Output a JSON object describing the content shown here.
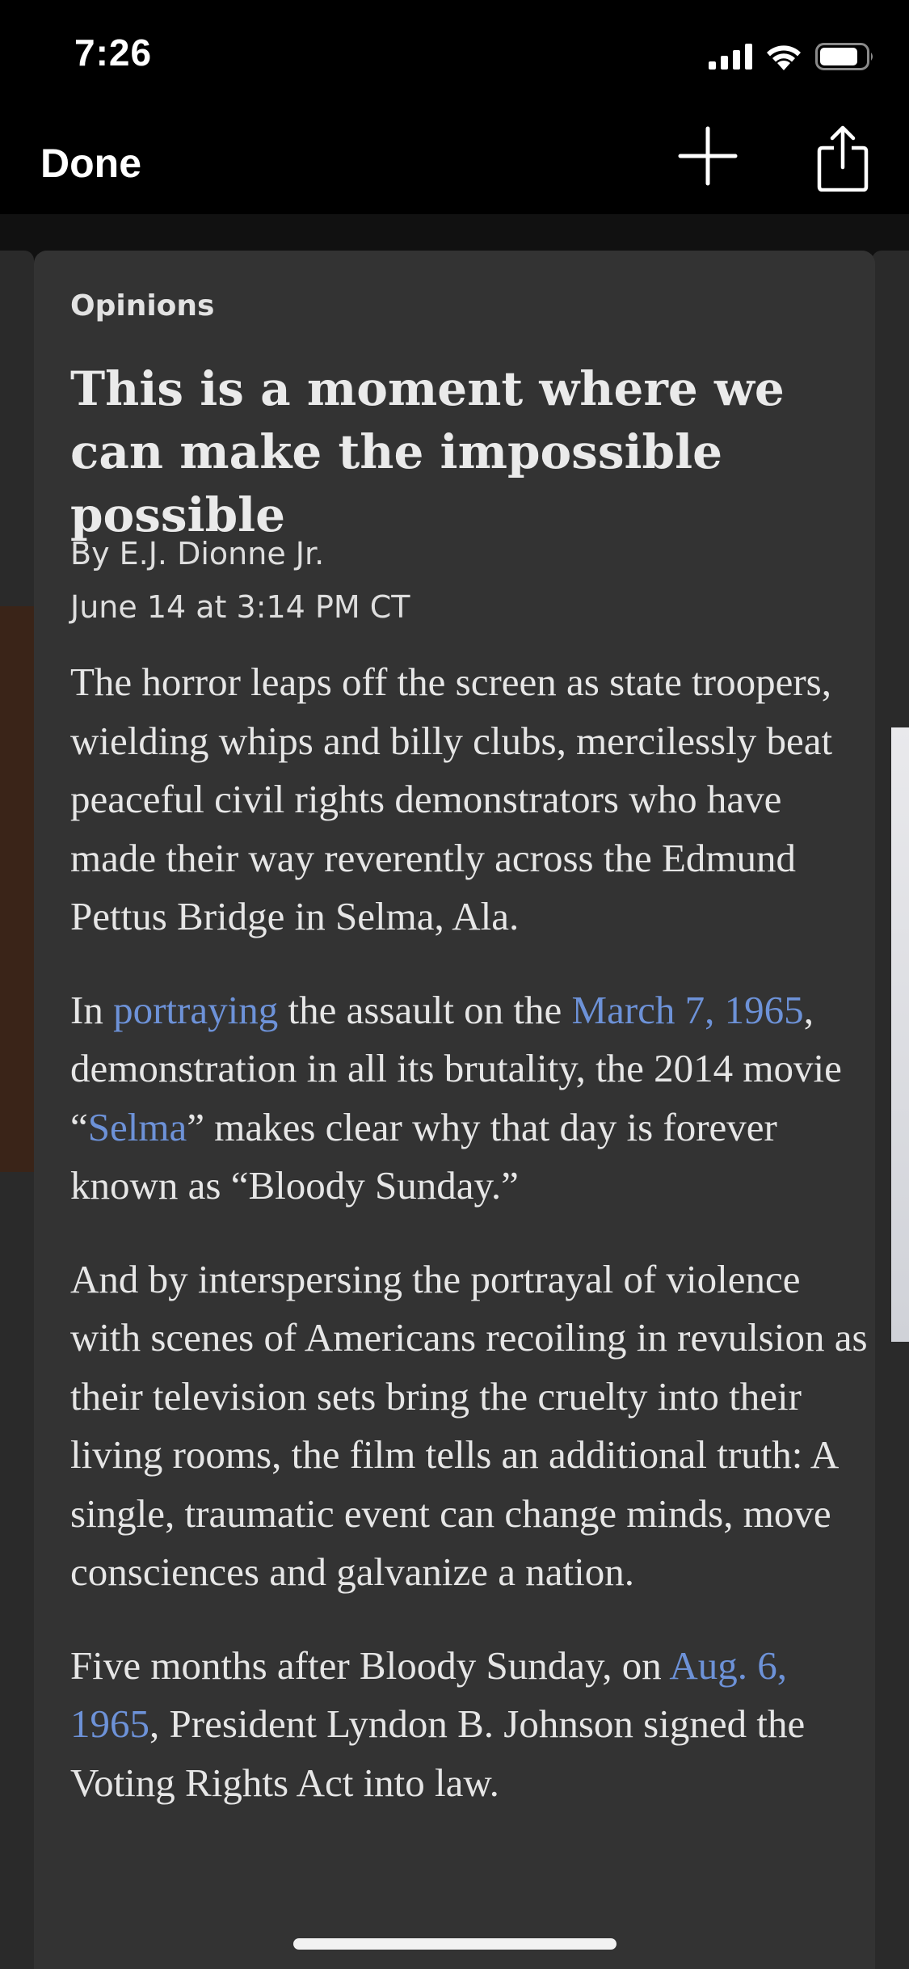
{
  "status_bar": {
    "time": "7:26"
  },
  "nav": {
    "done_label": "Done",
    "add_icon": "plus-icon",
    "share_icon": "share-icon"
  },
  "article": {
    "section": "Opinions",
    "headline": "This is a moment where we can make the impossible possible",
    "author": "By E.J. Dionne Jr.",
    "date": "June 14 at 3:14 PM CT",
    "paragraphs": [
      [
        {
          "text": "The horror leaps off the screen as state troopers, wielding whips and billy clubs, mercilessly beat peaceful civil rights demonstrators who have made their way reverently across the Edmund Pettus Bridge in Selma, Ala."
        }
      ],
      [
        {
          "text": "In "
        },
        {
          "text": "portraying",
          "link": true
        },
        {
          "text": " the assault on the "
        },
        {
          "text": "March 7, 1965",
          "link": true
        },
        {
          "text": ", demonstration in all its brutality, the 2014 movie “"
        },
        {
          "text": "Selma",
          "link": true
        },
        {
          "text": "” makes clear why that day is forever known as “Bloody Sunday.”"
        }
      ],
      [
        {
          "text": "And by interspersing the portrayal of vio­lence with scenes of Americans recoiling in revulsion as their television sets bring the cruelty into their living rooms, the film tells an additional truth: A single, traumat­ic event can change minds, move con­sciences and galvanize a nation."
        }
      ],
      [
        {
          "text": "Five months after Bloody Sunday, on "
        },
        {
          "text": "Aug. 6, 1965",
          "link": true
        },
        {
          "text": ", President Lyndon B. Johnson signed the Voting Rights Act into law."
        }
      ]
    ]
  },
  "colors": {
    "link": "#6d92d8",
    "card_background": "#333333",
    "page_background": "#000000"
  }
}
